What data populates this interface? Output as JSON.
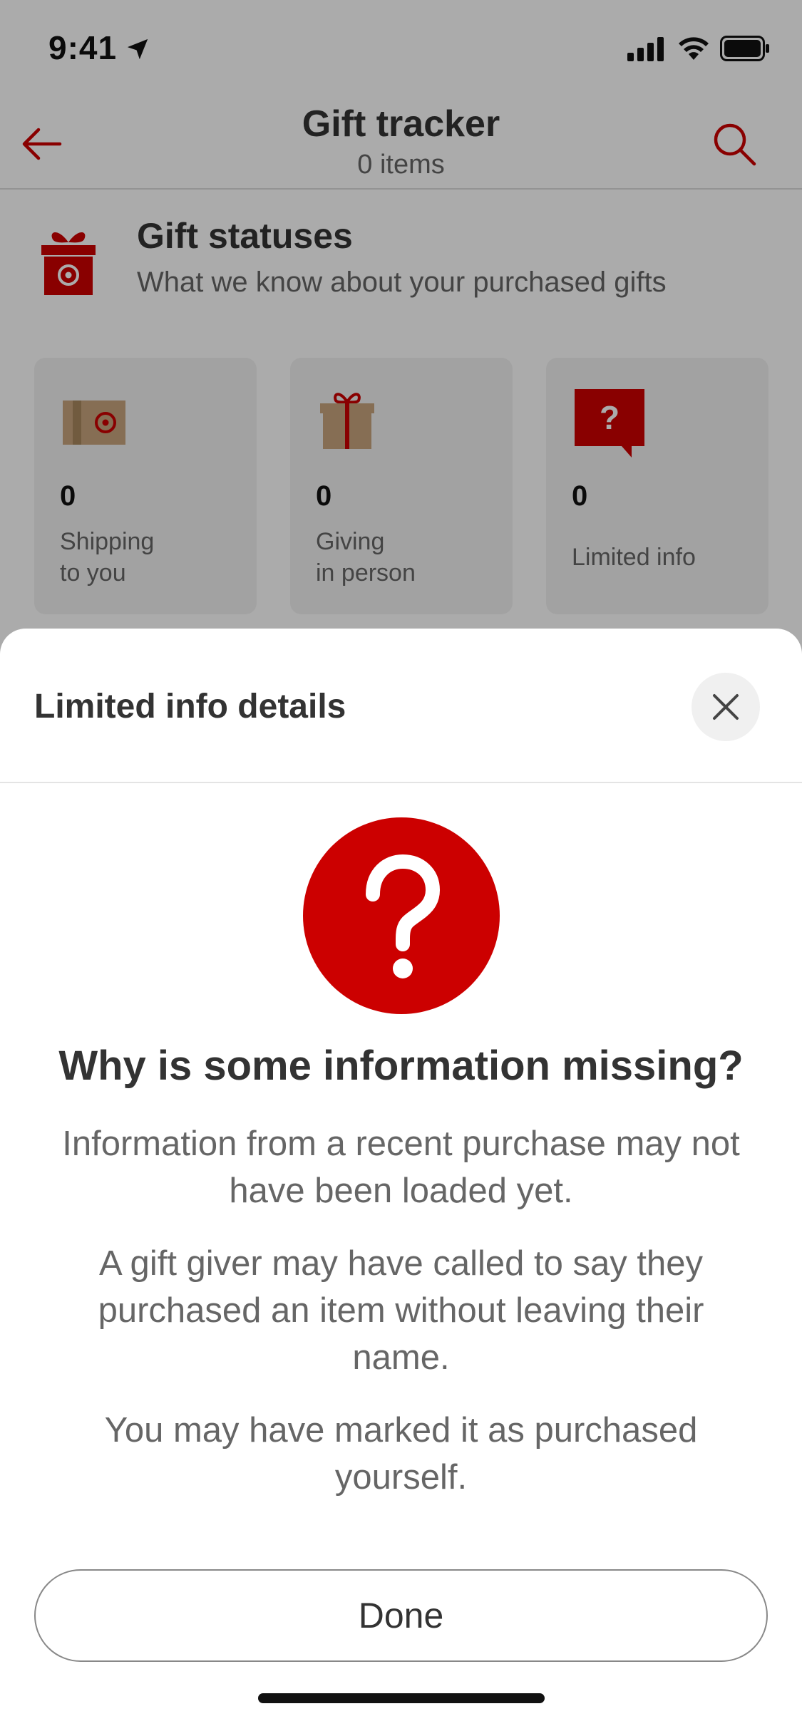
{
  "status_bar": {
    "time": "9:41"
  },
  "header": {
    "title": "Gift tracker",
    "subtitle": "0 items"
  },
  "gift_statuses": {
    "title": "Gift statuses",
    "subtitle": "What we know about your purchased gifts",
    "cards": [
      {
        "count": "0",
        "label": "Shipping\nto you",
        "icon": "shipping-box-icon"
      },
      {
        "count": "0",
        "label": "Giving\nin person",
        "icon": "gift-box-icon"
      },
      {
        "count": "0",
        "label": "Limited info",
        "icon": "question-bubble-icon"
      }
    ]
  },
  "sheet": {
    "title": "Limited info details",
    "headline": "Why is some information missing?",
    "paragraphs": [
      "Information from a recent purchase may not have been loaded yet.",
      "A gift giver may have called to say they purchased an item without leaving their name.",
      "You may have marked it as purchased yourself."
    ],
    "done_label": "Done"
  },
  "colors": {
    "brand_red": "#cc0000",
    "text_dark": "#333333",
    "text_muted": "#666666"
  }
}
